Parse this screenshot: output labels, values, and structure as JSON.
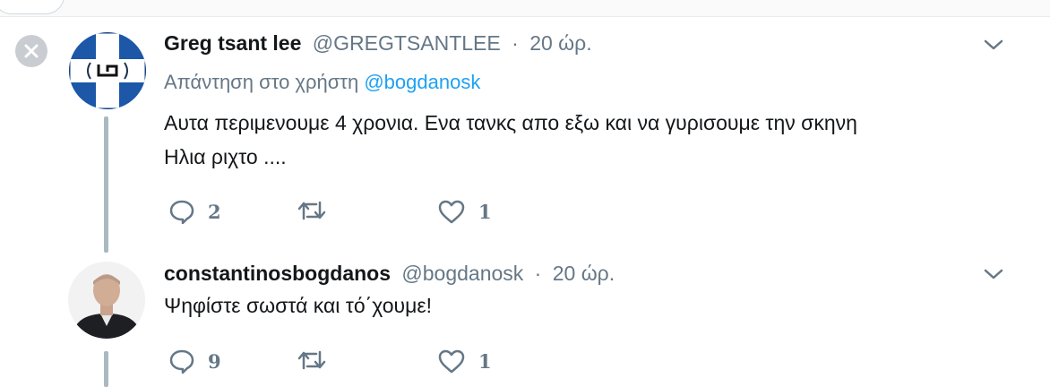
{
  "tweets": [
    {
      "name": "Greg tsant lee",
      "handle": "@GREGTSANTLEE",
      "separator": "·",
      "time": "20 ώρ.",
      "reply_prefix": "Απάντηση στο χρήστη",
      "reply_mention": "@bogdanosk",
      "text_lines": [
        "Αυτα περιμενουμε 4 χρονια. Ενα τανκς απο εξω και να γυρισουμε την σκηνη",
        "Ηλια ριχτο ...."
      ],
      "reply_count": "2",
      "like_count": "1"
    },
    {
      "name": "constantinosbogdanos",
      "handle": "@bogdanosk",
      "separator": "·",
      "time": "20 ώρ.",
      "text_lines": [
        "Ψηφίστε σωστά και τό΄χουμε!"
      ],
      "reply_count": "9",
      "like_count": "1"
    }
  ],
  "colors": {
    "icon": "#657786",
    "mention": "#1da1f2",
    "thread_line": "#aab8c2",
    "flag_blue": "#1c57a8"
  }
}
